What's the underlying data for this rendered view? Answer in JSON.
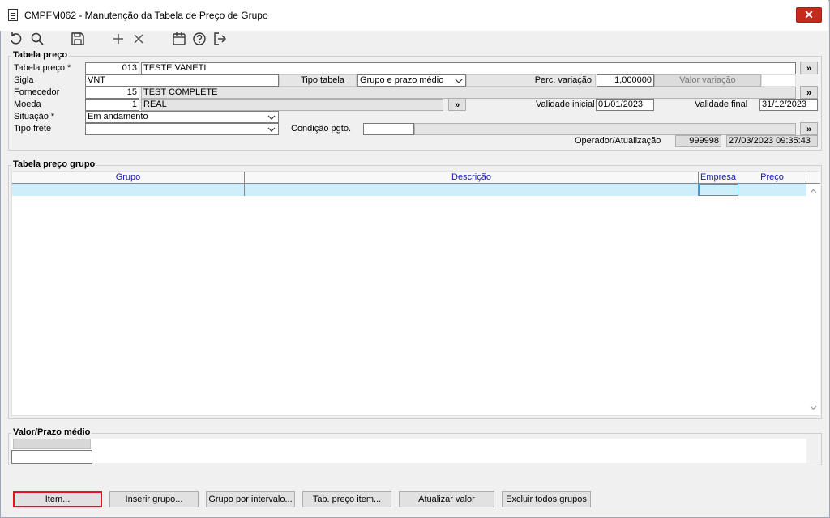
{
  "window": {
    "title": "CMPFM062 - Manutenção da Tabela de Preço de Grupo",
    "close_glyph": "✕"
  },
  "toolbar": {
    "icons": [
      "undo-icon",
      "search-icon",
      "save-icon",
      "add-icon",
      "delete-icon",
      "calendar-icon",
      "help-icon",
      "exit-icon"
    ]
  },
  "tabela_preco": {
    "group_title": "Tabela preço",
    "tabela_label": "Tabela preço *",
    "tabela_code": "013",
    "tabela_desc": "TESTE VANETI",
    "sigla_label": "Sigla",
    "sigla_value": "VNT",
    "tipo_tabela_label": "Tipo tabela",
    "tipo_tabela_value": "Grupo e prazo médio",
    "perc_variacao_label": "Perc. variação",
    "perc_variacao_value": "1,000000",
    "valor_variacao_label": "Valor variação",
    "fornecedor_label": "Fornecedor",
    "fornecedor_code": "15",
    "fornecedor_desc": "TEST COMPLETE",
    "moeda_label": "Moeda",
    "moeda_code": "1",
    "moeda_desc": "REAL",
    "validade_inicial_label": "Validade inicial",
    "validade_inicial_value": "01/01/2023",
    "validade_final_label": "Validade final",
    "validade_final_value": "31/12/2023",
    "situacao_label": "Situação *",
    "situacao_value": "Em andamento",
    "tipo_frete_label": "Tipo frete",
    "tipo_frete_value": "",
    "condicao_label": "Condição pgto.",
    "operador_label": "Operador/Atualização",
    "operador_value": "999998",
    "atualizacao_value": "27/03/2023 09:35:43",
    "lookup_glyph": "»"
  },
  "grupo": {
    "group_title": "Tabela preço grupo",
    "columns": [
      "Grupo",
      "Descrição",
      "Empresa",
      "Preço"
    ]
  },
  "valor_prazo": {
    "group_title": "Valor/Prazo médio"
  },
  "buttons": {
    "item": {
      "u": "I",
      "rest": "tem..."
    },
    "inserir": {
      "u": "I",
      "rest": "nserir grupo..."
    },
    "intervalo": {
      "pre": "Grupo por interval",
      "u": "o",
      "rest": "..."
    },
    "tab_preco": {
      "u": "T",
      "rest": "ab. preço item..."
    },
    "atualizar": {
      "u": "A",
      "rest": "tualizar valor"
    },
    "excluir": {
      "pre": "Ex",
      "u": "c",
      "rest": "luir todos grupos"
    }
  }
}
